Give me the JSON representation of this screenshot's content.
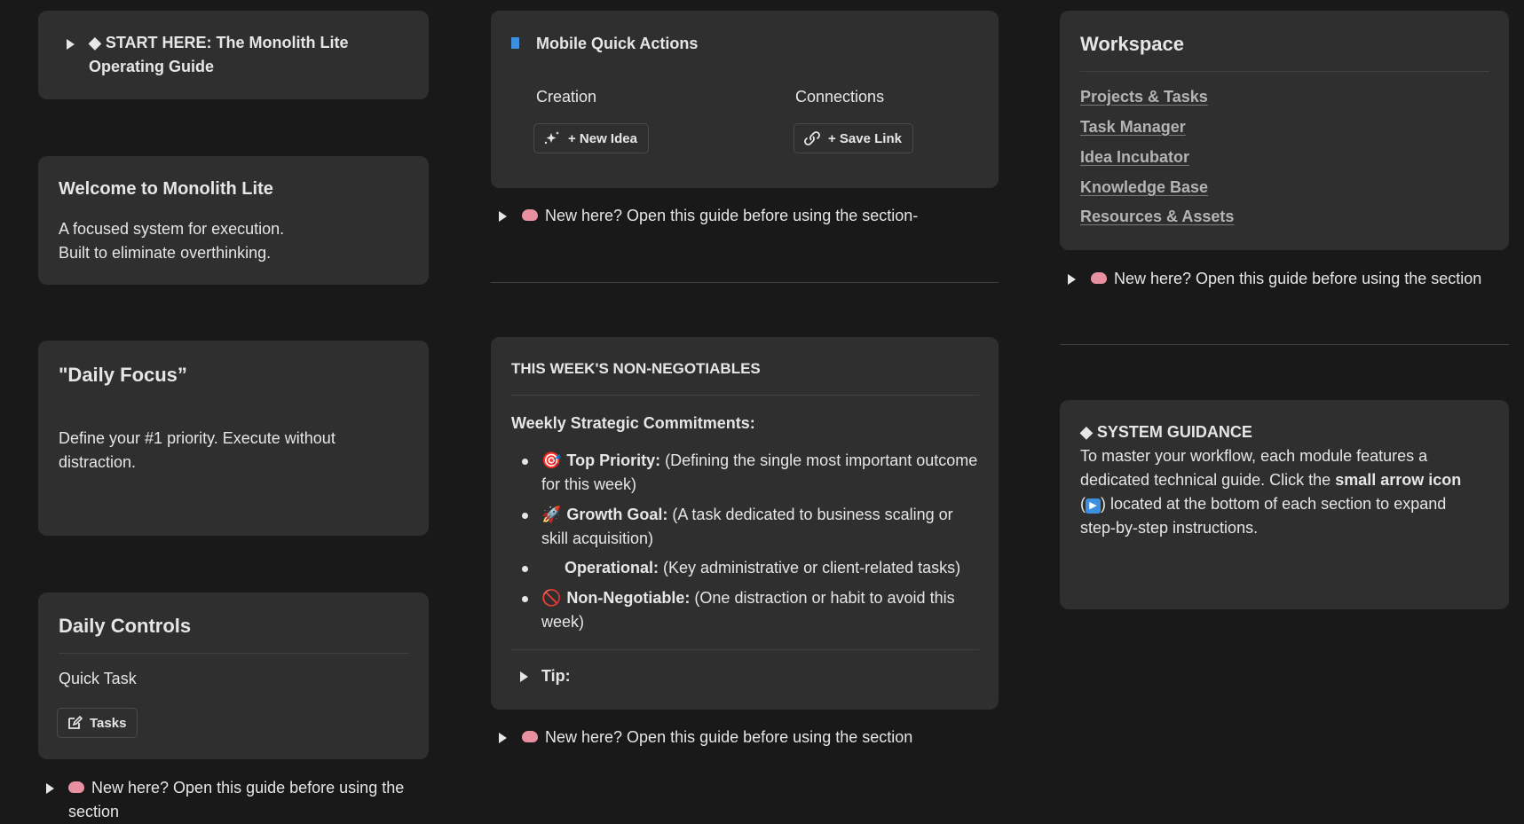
{
  "col1": {
    "start_here": {
      "title": "◆ START HERE: The Monolith Lite Operating Guide"
    },
    "welcome": {
      "title": "Welcome to Monolith Lite",
      "line1": "A focused system for execution.",
      "line2": "Built to eliminate overthinking."
    },
    "daily_focus": {
      "title": "\"Daily Focus”",
      "body": "Define your #1 priority. Execute without distraction."
    },
    "daily_controls": {
      "title": "Daily Controls",
      "quick_task": "Quick Task",
      "tasks_button": "Tasks"
    },
    "guide_toggle": "New here? Open this guide before using the section"
  },
  "col2": {
    "mobile": {
      "title": "Mobile Quick Actions",
      "creation_label": "Creation",
      "connections_label": "Connections",
      "new_idea_button": "+ New Idea",
      "save_link_button": "+ Save Link"
    },
    "guide_toggle_1": "New here? Open this guide before using the section-",
    "non_negotiables": {
      "title": "THIS WEEK'S NON-NEGOTIABLES",
      "subtitle": "Weekly Strategic Commitments:",
      "items": [
        {
          "emoji": "🎯",
          "label": "Top Priority:",
          "text": " (Defining the single most important outcome for this week)"
        },
        {
          "emoji": "🚀",
          "label": "Growth Goal:",
          "text": " (A task dedicated to business scaling or skill acquisition)"
        },
        {
          "emoji": "",
          "label": "Operational:",
          "text": " (Key administrative or client-related tasks)"
        },
        {
          "emoji": "🚫",
          "label": "Non-Negotiable:",
          "text": " (One distraction or habit to avoid this week)"
        }
      ],
      "tip": "Tip:"
    },
    "guide_toggle_2": "New here? Open this guide before using the section"
  },
  "col3": {
    "workspace": {
      "title": "Workspace",
      "links": [
        "Projects & Tasks",
        "Task Manager",
        "Idea Incubator",
        "Knowledge Base",
        "Resources & Assets"
      ]
    },
    "guide_toggle": "New here? Open this guide before using the section",
    "guidance": {
      "title": "◆ SYSTEM GUIDANCE",
      "text_1": "To master your workflow, each module features a dedicated technical guide. Click the ",
      "text_bold": "small arrow icon",
      "text_2": " (",
      "text_icon": "▶",
      "text_3": ") located at the bottom of each section to expand step-by-step instructions."
    }
  },
  "colors": {
    "background": "#191919",
    "card": "#2f2f2f",
    "accent_blue": "#3d8fe0"
  }
}
